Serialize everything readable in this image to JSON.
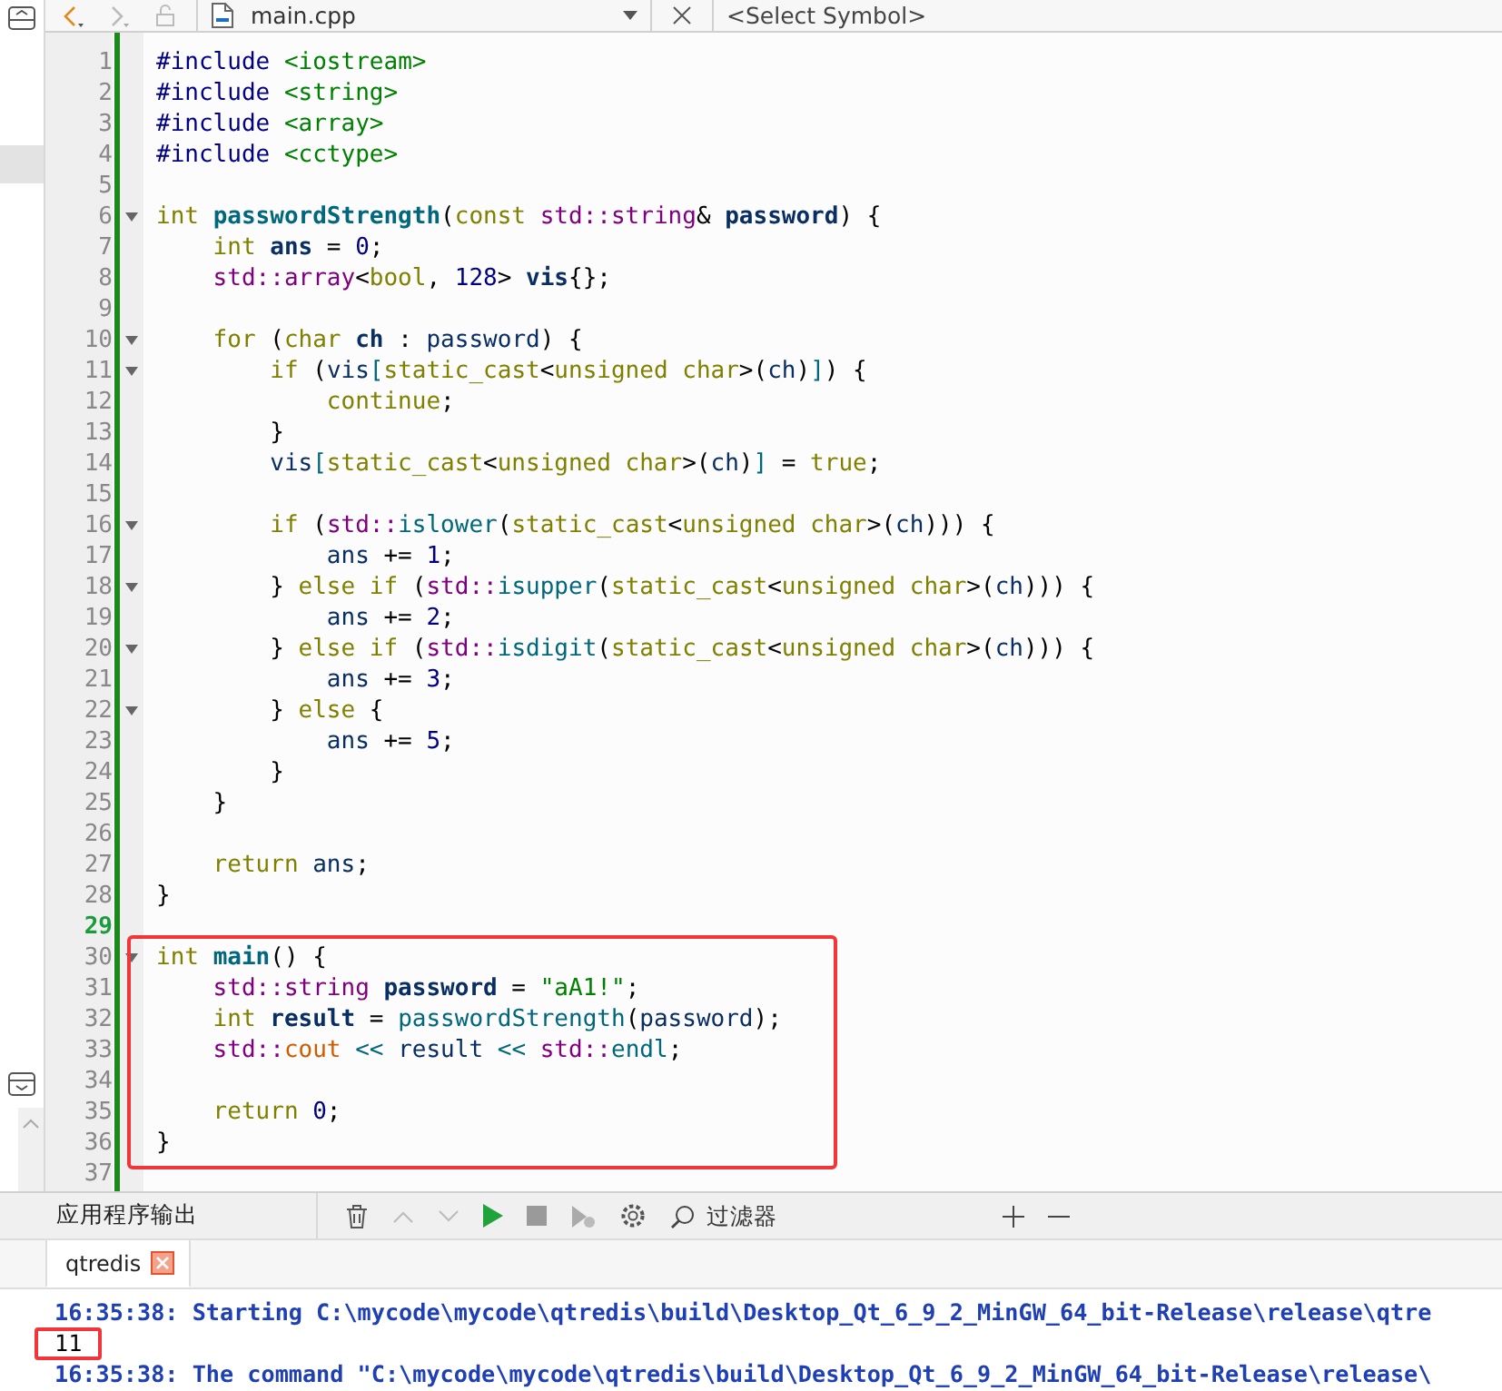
{
  "editor_toolbar": {
    "file_name": "main.cpp",
    "symbol_selector": "<Select Symbol>",
    "back_enabled": true,
    "forward_enabled": false
  },
  "code": {
    "lines": [
      {
        "number": "1",
        "fold": false,
        "current": false,
        "boxed": false,
        "tokens": [
          {
            "kind": "preprocessor",
            "text": "#include "
          },
          {
            "kind": "string",
            "text": "<iostream>"
          }
        ]
      },
      {
        "number": "2",
        "fold": false,
        "current": false,
        "boxed": false,
        "tokens": [
          {
            "kind": "preprocessor",
            "text": "#include "
          },
          {
            "kind": "string",
            "text": "<string>"
          }
        ]
      },
      {
        "number": "3",
        "fold": false,
        "current": false,
        "boxed": false,
        "tokens": [
          {
            "kind": "preprocessor",
            "text": "#include "
          },
          {
            "kind": "string",
            "text": "<array>"
          }
        ]
      },
      {
        "number": "4",
        "fold": false,
        "current": false,
        "boxed": false,
        "tokens": [
          {
            "kind": "preprocessor",
            "text": "#include "
          },
          {
            "kind": "string",
            "text": "<cctype>"
          }
        ]
      },
      {
        "number": "5",
        "fold": false,
        "current": false,
        "boxed": false
      },
      {
        "number": "6",
        "fold": true,
        "current": false,
        "boxed": false,
        "tokens": [
          {
            "kind": "keyword",
            "text": "int "
          },
          {
            "kind": "declaration",
            "text": "passwordStrength"
          },
          {
            "kind": "plain",
            "text": "("
          },
          {
            "kind": "keyword",
            "text": "const "
          },
          {
            "kind": "type",
            "text": "std::string"
          },
          {
            "kind": "plain",
            "text": "& "
          },
          {
            "kind": "local",
            "text": "password"
          },
          {
            "kind": "plain",
            "text": ") {"
          }
        ]
      },
      {
        "number": "7",
        "fold": false,
        "current": false,
        "boxed": false,
        "tokens": [
          {
            "kind": "keyword",
            "text": "    int "
          },
          {
            "kind": "local",
            "text": "ans"
          },
          {
            "kind": "plain",
            "text": " = "
          },
          {
            "kind": "number",
            "text": "0"
          },
          {
            "kind": "plain",
            "text": ";"
          }
        ]
      },
      {
        "number": "8",
        "fold": false,
        "current": false,
        "boxed": false,
        "tokens": [
          {
            "kind": "type",
            "text": "    std::array"
          },
          {
            "kind": "plain",
            "text": "<"
          },
          {
            "kind": "keyword",
            "text": "bool"
          },
          {
            "kind": "plain",
            "text": ", "
          },
          {
            "kind": "number",
            "text": "128"
          },
          {
            "kind": "plain",
            "text": "> "
          },
          {
            "kind": "local",
            "text": "vis"
          },
          {
            "kind": "plain",
            "text": "{};"
          }
        ]
      },
      {
        "number": "9",
        "fold": false,
        "current": false,
        "boxed": false
      },
      {
        "number": "10",
        "fold": true,
        "current": false,
        "boxed": false,
        "tokens": [
          {
            "kind": "keyword",
            "text": "    for"
          },
          {
            "kind": "plain",
            "text": " ("
          },
          {
            "kind": "keyword",
            "text": "char "
          },
          {
            "kind": "local",
            "text": "ch"
          },
          {
            "kind": "plain",
            "text": " : "
          },
          {
            "kind": "variable",
            "text": "password"
          },
          {
            "kind": "plain",
            "text": ") {"
          }
        ]
      },
      {
        "number": "11",
        "fold": true,
        "current": false,
        "boxed": false,
        "tokens": [
          {
            "kind": "keyword",
            "text": "        if"
          },
          {
            "kind": "plain",
            "text": " ("
          },
          {
            "kind": "variable",
            "text": "vis"
          },
          {
            "kind": "function",
            "text": "["
          },
          {
            "kind": "keyword",
            "text": "static_cast"
          },
          {
            "kind": "plain",
            "text": "<"
          },
          {
            "kind": "keyword",
            "text": "unsigned char"
          },
          {
            "kind": "plain",
            "text": ">("
          },
          {
            "kind": "variable",
            "text": "ch"
          },
          {
            "kind": "plain",
            "text": ")"
          },
          {
            "kind": "function",
            "text": "]"
          },
          {
            "kind": "plain",
            "text": ") {"
          }
        ]
      },
      {
        "number": "12",
        "fold": false,
        "current": false,
        "boxed": false,
        "tokens": [
          {
            "kind": "keyword",
            "text": "            continue"
          },
          {
            "kind": "plain",
            "text": ";"
          }
        ]
      },
      {
        "number": "13",
        "fold": false,
        "current": false,
        "boxed": false,
        "tokens": [
          {
            "kind": "plain",
            "text": "        }"
          }
        ]
      },
      {
        "number": "14",
        "fold": false,
        "current": false,
        "boxed": false,
        "tokens": [
          {
            "kind": "variable",
            "text": "        vis"
          },
          {
            "kind": "function",
            "text": "["
          },
          {
            "kind": "keyword",
            "text": "static_cast"
          },
          {
            "kind": "plain",
            "text": "<"
          },
          {
            "kind": "keyword",
            "text": "unsigned char"
          },
          {
            "kind": "plain",
            "text": ">("
          },
          {
            "kind": "variable",
            "text": "ch"
          },
          {
            "kind": "plain",
            "text": ")"
          },
          {
            "kind": "function",
            "text": "]"
          },
          {
            "kind": "plain",
            "text": " = "
          },
          {
            "kind": "keyword",
            "text": "true"
          },
          {
            "kind": "plain",
            "text": ";"
          }
        ]
      },
      {
        "number": "15",
        "fold": false,
        "current": false,
        "boxed": false
      },
      {
        "number": "16",
        "fold": true,
        "current": false,
        "boxed": false,
        "tokens": [
          {
            "kind": "keyword",
            "text": "        if"
          },
          {
            "kind": "plain",
            "text": " ("
          },
          {
            "kind": "type",
            "text": "std::"
          },
          {
            "kind": "function",
            "text": "islower"
          },
          {
            "kind": "plain",
            "text": "("
          },
          {
            "kind": "keyword",
            "text": "static_cast"
          },
          {
            "kind": "plain",
            "text": "<"
          },
          {
            "kind": "keyword",
            "text": "unsigned char"
          },
          {
            "kind": "plain",
            "text": ">("
          },
          {
            "kind": "variable",
            "text": "ch"
          },
          {
            "kind": "plain",
            "text": "))) {"
          }
        ]
      },
      {
        "number": "17",
        "fold": false,
        "current": false,
        "boxed": false,
        "tokens": [
          {
            "kind": "variable",
            "text": "            ans"
          },
          {
            "kind": "plain",
            "text": " += "
          },
          {
            "kind": "number",
            "text": "1"
          },
          {
            "kind": "plain",
            "text": ";"
          }
        ]
      },
      {
        "number": "18",
        "fold": true,
        "current": false,
        "boxed": false,
        "tokens": [
          {
            "kind": "plain",
            "text": "        } "
          },
          {
            "kind": "keyword",
            "text": "else if"
          },
          {
            "kind": "plain",
            "text": " ("
          },
          {
            "kind": "type",
            "text": "std::"
          },
          {
            "kind": "function",
            "text": "isupper"
          },
          {
            "kind": "plain",
            "text": "("
          },
          {
            "kind": "keyword",
            "text": "static_cast"
          },
          {
            "kind": "plain",
            "text": "<"
          },
          {
            "kind": "keyword",
            "text": "unsigned char"
          },
          {
            "kind": "plain",
            "text": ">("
          },
          {
            "kind": "variable",
            "text": "ch"
          },
          {
            "kind": "plain",
            "text": "))) {"
          }
        ]
      },
      {
        "number": "19",
        "fold": false,
        "current": false,
        "boxed": false,
        "tokens": [
          {
            "kind": "variable",
            "text": "            ans"
          },
          {
            "kind": "plain",
            "text": " += "
          },
          {
            "kind": "number",
            "text": "2"
          },
          {
            "kind": "plain",
            "text": ";"
          }
        ]
      },
      {
        "number": "20",
        "fold": true,
        "current": false,
        "boxed": false,
        "tokens": [
          {
            "kind": "plain",
            "text": "        } "
          },
          {
            "kind": "keyword",
            "text": "else if"
          },
          {
            "kind": "plain",
            "text": " ("
          },
          {
            "kind": "type",
            "text": "std::"
          },
          {
            "kind": "function",
            "text": "isdigit"
          },
          {
            "kind": "plain",
            "text": "("
          },
          {
            "kind": "keyword",
            "text": "static_cast"
          },
          {
            "kind": "plain",
            "text": "<"
          },
          {
            "kind": "keyword",
            "text": "unsigned char"
          },
          {
            "kind": "plain",
            "text": ">("
          },
          {
            "kind": "variable",
            "text": "ch"
          },
          {
            "kind": "plain",
            "text": "))) {"
          }
        ]
      },
      {
        "number": "21",
        "fold": false,
        "current": false,
        "boxed": false,
        "tokens": [
          {
            "kind": "variable",
            "text": "            ans"
          },
          {
            "kind": "plain",
            "text": " += "
          },
          {
            "kind": "number",
            "text": "3"
          },
          {
            "kind": "plain",
            "text": ";"
          }
        ]
      },
      {
        "number": "22",
        "fold": true,
        "current": false,
        "boxed": false,
        "tokens": [
          {
            "kind": "plain",
            "text": "        } "
          },
          {
            "kind": "keyword",
            "text": "else"
          },
          {
            "kind": "plain",
            "text": " {"
          }
        ]
      },
      {
        "number": "23",
        "fold": false,
        "current": false,
        "boxed": false,
        "tokens": [
          {
            "kind": "variable",
            "text": "            ans"
          },
          {
            "kind": "plain",
            "text": " += "
          },
          {
            "kind": "number",
            "text": "5"
          },
          {
            "kind": "plain",
            "text": ";"
          }
        ]
      },
      {
        "number": "24",
        "fold": false,
        "current": false,
        "boxed": false,
        "tokens": [
          {
            "kind": "plain",
            "text": "        }"
          }
        ]
      },
      {
        "number": "25",
        "fold": false,
        "current": false,
        "boxed": false,
        "tokens": [
          {
            "kind": "plain",
            "text": "    }"
          }
        ]
      },
      {
        "number": "26",
        "fold": false,
        "current": false,
        "boxed": false
      },
      {
        "number": "27",
        "fold": false,
        "current": false,
        "boxed": false,
        "tokens": [
          {
            "kind": "keyword",
            "text": "    return "
          },
          {
            "kind": "variable",
            "text": "ans"
          },
          {
            "kind": "plain",
            "text": ";"
          }
        ]
      },
      {
        "number": "28",
        "fold": false,
        "current": false,
        "boxed": false,
        "tokens": [
          {
            "kind": "plain",
            "text": "}"
          }
        ]
      },
      {
        "number": "29",
        "fold": false,
        "current": true,
        "boxed": false
      },
      {
        "number": "30",
        "fold": true,
        "current": false,
        "boxed": true,
        "tokens": [
          {
            "kind": "keyword",
            "text": "int "
          },
          {
            "kind": "declaration",
            "text": "main"
          },
          {
            "kind": "plain",
            "text": "() {"
          }
        ]
      },
      {
        "number": "31",
        "fold": false,
        "current": false,
        "boxed": true,
        "tokens": [
          {
            "kind": "type",
            "text": "    std::string "
          },
          {
            "kind": "local",
            "text": "password"
          },
          {
            "kind": "plain",
            "text": " = "
          },
          {
            "kind": "string",
            "text": "\"aA1!\""
          },
          {
            "kind": "plain",
            "text": ";"
          }
        ]
      },
      {
        "number": "32",
        "fold": false,
        "current": false,
        "boxed": true,
        "tokens": [
          {
            "kind": "keyword",
            "text": "    int "
          },
          {
            "kind": "local",
            "text": "result"
          },
          {
            "kind": "plain",
            "text": " = "
          },
          {
            "kind": "function",
            "text": "passwordStrength"
          },
          {
            "kind": "plain",
            "text": "("
          },
          {
            "kind": "variable",
            "text": "password"
          },
          {
            "kind": "plain",
            "text": ");"
          }
        ]
      },
      {
        "number": "33",
        "fold": false,
        "current": false,
        "boxed": true,
        "tokens": [
          {
            "kind": "type",
            "text": "    std::"
          },
          {
            "kind": "stream",
            "text": "cout"
          },
          {
            "kind": "function",
            "text": " << "
          },
          {
            "kind": "variable",
            "text": "result"
          },
          {
            "kind": "function",
            "text": " << "
          },
          {
            "kind": "type",
            "text": "std::"
          },
          {
            "kind": "function",
            "text": "endl"
          },
          {
            "kind": "plain",
            "text": ";"
          }
        ]
      },
      {
        "number": "34",
        "fold": false,
        "current": false,
        "boxed": true
      },
      {
        "number": "35",
        "fold": false,
        "current": false,
        "boxed": true,
        "tokens": [
          {
            "kind": "keyword",
            "text": "    return "
          },
          {
            "kind": "number",
            "text": "0"
          },
          {
            "kind": "plain",
            "text": ";"
          }
        ]
      },
      {
        "number": "36",
        "fold": false,
        "current": false,
        "boxed": true,
        "tokens": [
          {
            "kind": "plain",
            "text": "}"
          }
        ]
      },
      {
        "number": "37",
        "fold": false,
        "current": false,
        "boxed": false
      }
    ]
  },
  "output_pane": {
    "title": "应用程序输出",
    "filter": {
      "placeholder": "过滤器"
    },
    "tabs": [
      {
        "label": "qtredis",
        "selected": true
      }
    ],
    "lines": [
      {
        "kind": "system",
        "boxed": false,
        "text": "16:35:38: Starting C:\\mycode\\mycode\\qtredis\\build\\Desktop_Qt_6_9_2_MinGW_64_bit-Release\\release\\qtre"
      },
      {
        "kind": "stdout",
        "boxed": true,
        "text": "11"
      },
      {
        "kind": "system",
        "boxed": false,
        "text": "16:35:38: The command \"C:\\mycode\\mycode\\qtredis\\build\\Desktop_Qt_6_9_2_MinGW_64_bit-Release\\release\\"
      }
    ]
  }
}
